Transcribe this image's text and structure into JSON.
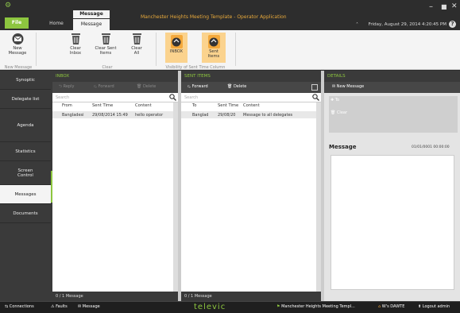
{
  "titlebar": {
    "window_title": "Manchester Heights Meeting Template - Operator Application",
    "date": "Friday, August 29, 2014 4:20:45 PM",
    "tabs": {
      "file": "File",
      "home": "Home",
      "context_label": "Message",
      "message": "Message"
    }
  },
  "ribbon": {
    "buttons": {
      "new_message": "New\nMessage",
      "clear_inbox": "Clear\nInbox",
      "clear_sent": "Clear Sent\nItems",
      "clear_all": "Clear\nAll",
      "inbox": "INBOX",
      "sent_items": "Sent\nItems"
    },
    "groups": {
      "new_message": "New Message",
      "clear": "Clear",
      "visibility": "Visibility of Sent Time Column"
    }
  },
  "sidebar": {
    "items": [
      "Synoptic",
      "Delegate list",
      "Agenda",
      "Statistics",
      "Screen\nControl",
      "Messages",
      "Documents"
    ]
  },
  "inbox": {
    "title": "INBOX",
    "toolbar": {
      "reply": "Reply",
      "forward": "Forward",
      "delete": "Delete"
    },
    "search_placeholder": "Search",
    "columns": [
      "From",
      "Sent Time",
      "Content"
    ],
    "rows": [
      {
        "from": "Bangladesi",
        "sent_time": "29/08/2014 15:49",
        "content": "hello operator"
      }
    ],
    "status": "0 / 1  Message"
  },
  "sent": {
    "title": "SENT ITEMS",
    "toolbar": {
      "forward": "Forward",
      "delete": "Delete"
    },
    "search_placeholder": "Search",
    "columns": [
      "To",
      "Sent Time",
      "Content"
    ],
    "rows": [
      {
        "to": "Banglad",
        "sent_time": "29/08/20",
        "content": "Message to all delegates"
      }
    ],
    "status": "0 / 1  Message"
  },
  "details": {
    "title": "DETAILS",
    "new_message": "New Message",
    "to_label": "To",
    "clear_label": "Clear",
    "message_heading": "Message",
    "message_date": "01/01/0001 00:00:00"
  },
  "bottombar": {
    "connections": "Connections",
    "faults": "Faults",
    "message": "Message",
    "brand": "televic",
    "meeting": "Manchester Heights Meeting Templ...",
    "user": "W's DAWTE",
    "logout": "Logout admin"
  },
  "colors": {
    "accent": "#8dc63f",
    "orange": "#f4a93c",
    "dark": "#3a3a3a"
  }
}
